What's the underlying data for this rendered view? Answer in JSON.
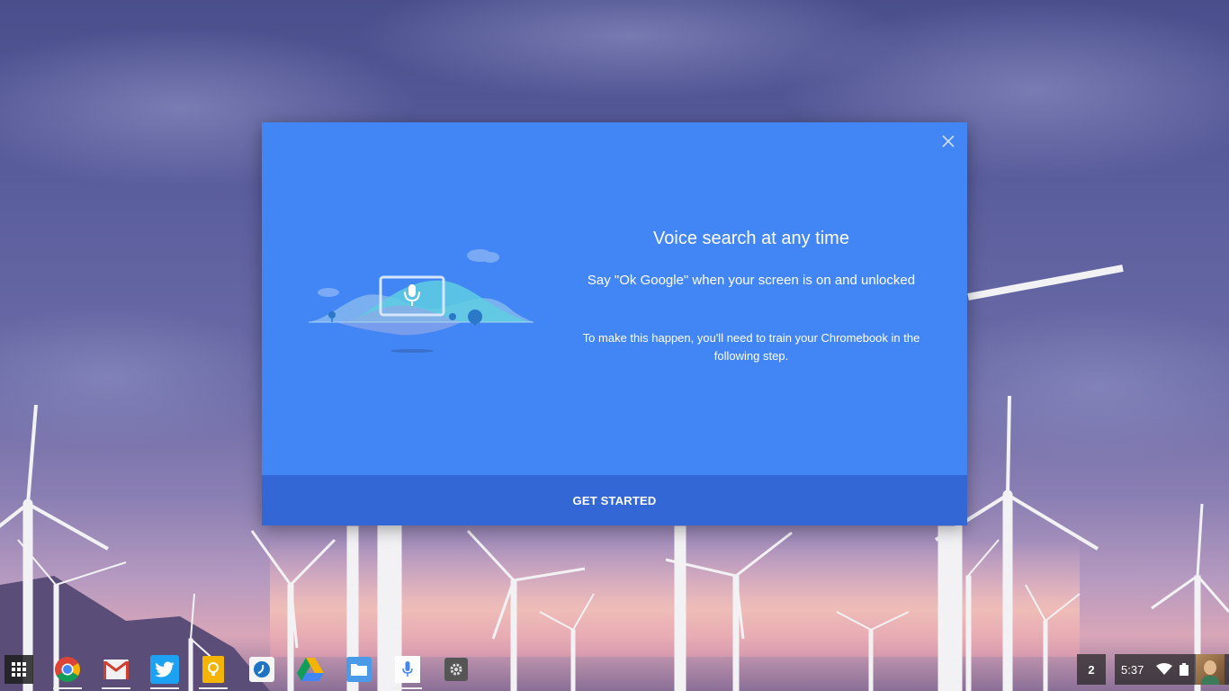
{
  "dialog": {
    "title": "Voice search at any time",
    "subtitle": "Say \"Ok Google\" when your screen is on and unlocked",
    "body": "To make this happen, you'll need to train your Chromebook in the following step.",
    "action_label": "GET STARTED",
    "accent_color": "#4285f4",
    "footer_color": "#3367d6"
  },
  "shelf": {
    "apps": [
      {
        "name": "app-launcher",
        "icon": "grid-icon"
      },
      {
        "name": "chrome",
        "icon": "chrome-icon"
      },
      {
        "name": "gmail",
        "icon": "gmail-icon"
      },
      {
        "name": "twitter",
        "icon": "twitter-icon"
      },
      {
        "name": "keep",
        "icon": "keep-icon"
      },
      {
        "name": "app",
        "icon": "app-icon"
      },
      {
        "name": "drive",
        "icon": "drive-icon"
      },
      {
        "name": "files",
        "icon": "folder-icon"
      },
      {
        "name": "voice-search",
        "icon": "microphone-icon"
      },
      {
        "name": "settings",
        "icon": "gear-icon"
      }
    ],
    "notification_count": "2",
    "time": "5:37"
  }
}
